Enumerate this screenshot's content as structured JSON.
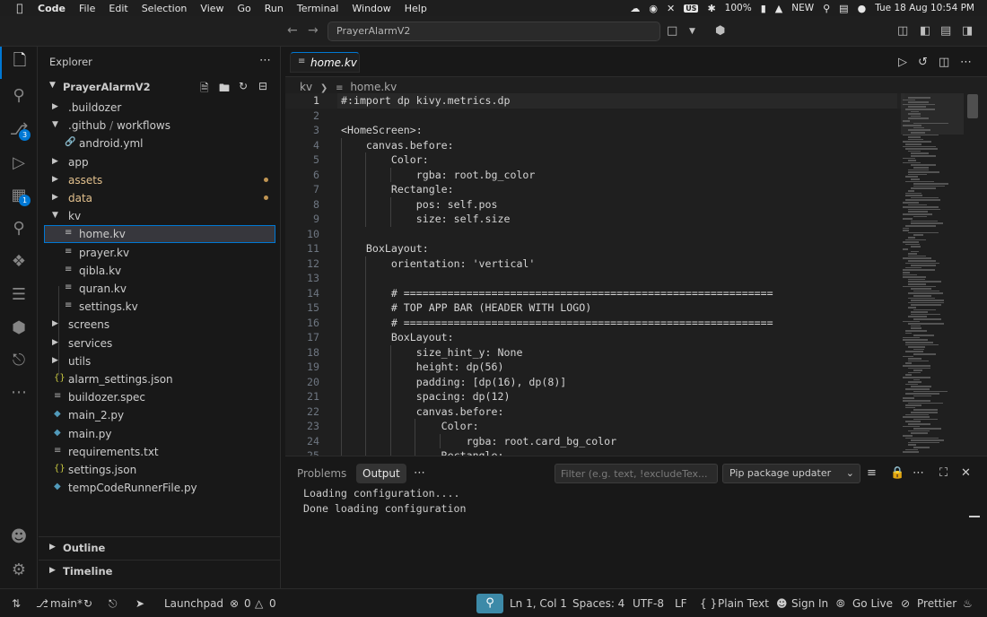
{
  "menubar": {
    "app": "Code",
    "items": [
      "File",
      "Edit",
      "Selection",
      "View",
      "Go",
      "Run",
      "Terminal",
      "Window",
      "Help"
    ],
    "input_source": "US",
    "battery": "100%",
    "new_label": "NEW",
    "datetime": "Tue 18 Aug  10:54 PM"
  },
  "titlebar": {
    "search": "PrayerAlarmV2"
  },
  "activity": {
    "source_control_badge": "3",
    "extensions_badge": "1"
  },
  "sidebar": {
    "title": "Explorer",
    "project": "PrayerAlarmV2",
    "tree": [
      {
        "label": ".buildozer",
        "type": "folder"
      },
      {
        "label": ".github",
        "sep": " / ",
        "label2": "workflows",
        "type": "folder",
        "open": true
      },
      {
        "label": "android.yml",
        "type": "yml"
      },
      {
        "label": "app",
        "type": "folder"
      },
      {
        "label": "assets",
        "type": "folder",
        "modified": true
      },
      {
        "label": "data",
        "type": "folder",
        "modified": true
      },
      {
        "label": "kv",
        "type": "folder",
        "open": true
      },
      {
        "label": "home.kv",
        "type": "kv",
        "selected": true
      },
      {
        "label": "prayer.kv",
        "type": "kv"
      },
      {
        "label": "qibla.kv",
        "type": "kv"
      },
      {
        "label": "quran.kv",
        "type": "kv"
      },
      {
        "label": "settings.kv",
        "type": "kv"
      },
      {
        "label": "screens",
        "type": "folder"
      },
      {
        "label": "services",
        "type": "folder"
      },
      {
        "label": "utils",
        "type": "folder"
      },
      {
        "label": "alarm_settings.json",
        "type": "json"
      },
      {
        "label": "buildozer.spec",
        "type": "file"
      },
      {
        "label": "main_2.py",
        "type": "py"
      },
      {
        "label": "main.py",
        "type": "py"
      },
      {
        "label": "requirements.txt",
        "type": "file"
      },
      {
        "label": "settings.json",
        "type": "json"
      },
      {
        "label": "tempCodeRunnerFile.py",
        "type": "py"
      }
    ],
    "outline": "Outline",
    "timeline": "Timeline"
  },
  "editor": {
    "tab": "home.kv",
    "breadcrumb": [
      "kv",
      "home.kv"
    ],
    "lines": [
      {
        "n": "1",
        "t": "#:import dp kivy.metrics.dp",
        "i": 0
      },
      {
        "n": "2",
        "t": "",
        "i": 0
      },
      {
        "n": "3",
        "t": "<HomeScreen>:",
        "i": 0
      },
      {
        "n": "4",
        "t": "    canvas.before:",
        "i": 1
      },
      {
        "n": "5",
        "t": "        Color:",
        "i": 2
      },
      {
        "n": "6",
        "t": "            rgba: root.bg_color",
        "i": 3
      },
      {
        "n": "7",
        "t": "        Rectangle:",
        "i": 2
      },
      {
        "n": "8",
        "t": "            pos: self.pos",
        "i": 3
      },
      {
        "n": "9",
        "t": "            size: self.size",
        "i": 3
      },
      {
        "n": "10",
        "t": "",
        "i": 1
      },
      {
        "n": "11",
        "t": "    BoxLayout:",
        "i": 1
      },
      {
        "n": "12",
        "t": "        orientation: 'vertical'",
        "i": 2
      },
      {
        "n": "13",
        "t": "",
        "i": 2
      },
      {
        "n": "14",
        "t": "        # ===========================================================",
        "i": 2
      },
      {
        "n": "15",
        "t": "        # TOP APP BAR (HEADER WITH LOGO)",
        "i": 2
      },
      {
        "n": "16",
        "t": "        # ===========================================================",
        "i": 2
      },
      {
        "n": "17",
        "t": "        BoxLayout:",
        "i": 2
      },
      {
        "n": "18",
        "t": "            size_hint_y: None",
        "i": 3
      },
      {
        "n": "19",
        "t": "            height: dp(56)",
        "i": 3
      },
      {
        "n": "20",
        "t": "            padding: [dp(16), dp(8)]",
        "i": 3
      },
      {
        "n": "21",
        "t": "            spacing: dp(12)",
        "i": 3
      },
      {
        "n": "22",
        "t": "            canvas.before:",
        "i": 3
      },
      {
        "n": "23",
        "t": "                Color:",
        "i": 4
      },
      {
        "n": "24",
        "t": "                    rgba: root.card_bg_color",
        "i": 5
      },
      {
        "n": "25",
        "t": "                Rectangle:",
        "i": 4
      }
    ]
  },
  "panel": {
    "tabs": [
      "Problems",
      "Output"
    ],
    "active_tab": "Output",
    "filter_placeholder": "Filter (e.g. text, !excludeTex...",
    "channel": "Pip package updater",
    "output": [
      "Loading configuration....",
      "Done loading configuration"
    ]
  },
  "statusbar": {
    "branch": "main*",
    "launchpad": "Launchpad",
    "errors": "0",
    "warnings": "0",
    "position": "Ln 1, Col 1",
    "spaces": "Spaces: 4",
    "encoding": "UTF-8",
    "eol": "LF",
    "language": "Plain Text",
    "sign_in": "Sign In",
    "go_live": "Go Live",
    "prettier": "Prettier"
  }
}
